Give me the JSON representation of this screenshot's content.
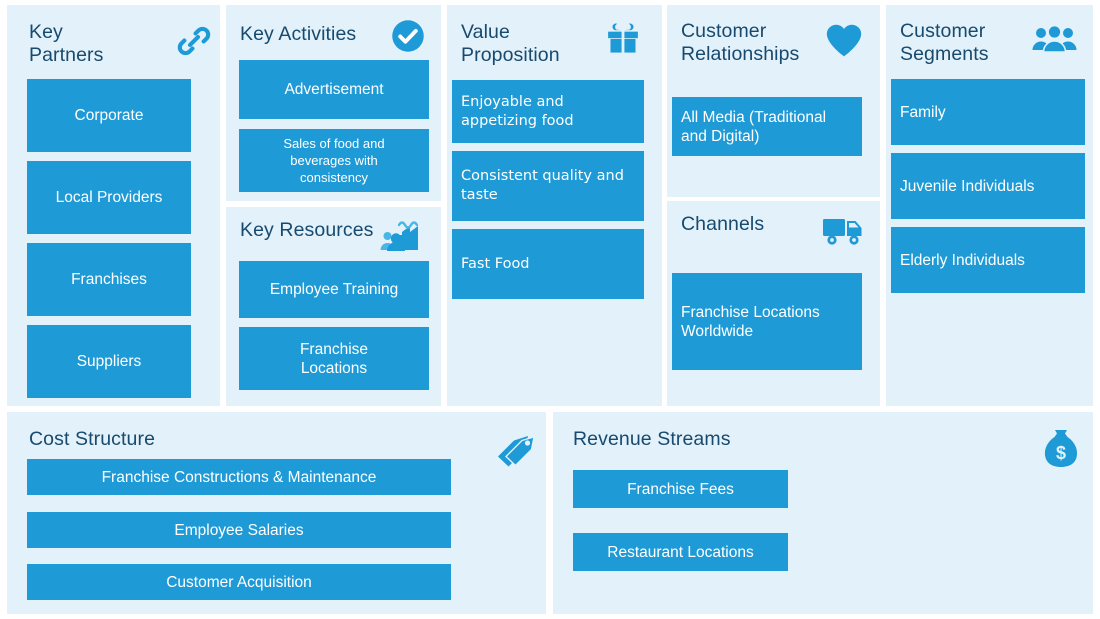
{
  "theme": {
    "panel_bg": "#e2f1fa",
    "card_bg": "#1e9ad6",
    "card_text": "#ffffff",
    "title_text": "#174a6e",
    "icon_color": "#1e9ad6",
    "page_bg": "#ffffff"
  },
  "blocks": {
    "key_partners": {
      "title": "Key\nPartners",
      "icon": "link-icon",
      "items": [
        {
          "label": "Corporate"
        },
        {
          "label": "Local Providers"
        },
        {
          "label": "Franchises"
        },
        {
          "label": "Suppliers"
        }
      ]
    },
    "key_activities": {
      "title": "Key Activities",
      "icon": "check-circle-icon",
      "items": [
        {
          "label": "Advertisement"
        },
        {
          "label": "Sales of food and\nbeverages with\nconsistency"
        }
      ]
    },
    "key_resources": {
      "title": "Key Resources",
      "icon": "factory-people-icon",
      "items": [
        {
          "label": "Employee Training"
        },
        {
          "label": "Franchise\nLocations"
        }
      ]
    },
    "value_proposition": {
      "title": "Value\nProposition",
      "icon": "gift-icon",
      "items": [
        {
          "label": "Enjoyable and\nappetizing food"
        },
        {
          "label": "Consistent quality and\ntaste"
        },
        {
          "label": "Fast Food"
        }
      ]
    },
    "customer_relationships": {
      "title": "Customer\nRelationships",
      "icon": "heart-icon",
      "items": [
        {
          "label": "All Media (Traditional\nand Digital)"
        }
      ]
    },
    "channels": {
      "title": "Channels",
      "icon": "truck-icon",
      "items": [
        {
          "label": "Franchise Locations\nWorldwide"
        }
      ]
    },
    "customer_segments": {
      "title": "Customer\nSegments",
      "icon": "people-group-icon",
      "items": [
        {
          "label": "Family"
        },
        {
          "label": "Juvenile Individuals"
        },
        {
          "label": "Elderly Individuals"
        }
      ]
    },
    "cost_structure": {
      "title": "Cost Structure",
      "icon": "price-tag-icon",
      "items": [
        {
          "label": "Franchise Constructions & Maintenance"
        },
        {
          "label": "Employee Salaries"
        },
        {
          "label": "Customer Acquisition"
        }
      ]
    },
    "revenue_streams": {
      "title": "Revenue Streams",
      "icon": "money-bag-icon",
      "items": [
        {
          "label": "Franchise Fees"
        },
        {
          "label": "Restaurant Locations"
        }
      ]
    }
  }
}
